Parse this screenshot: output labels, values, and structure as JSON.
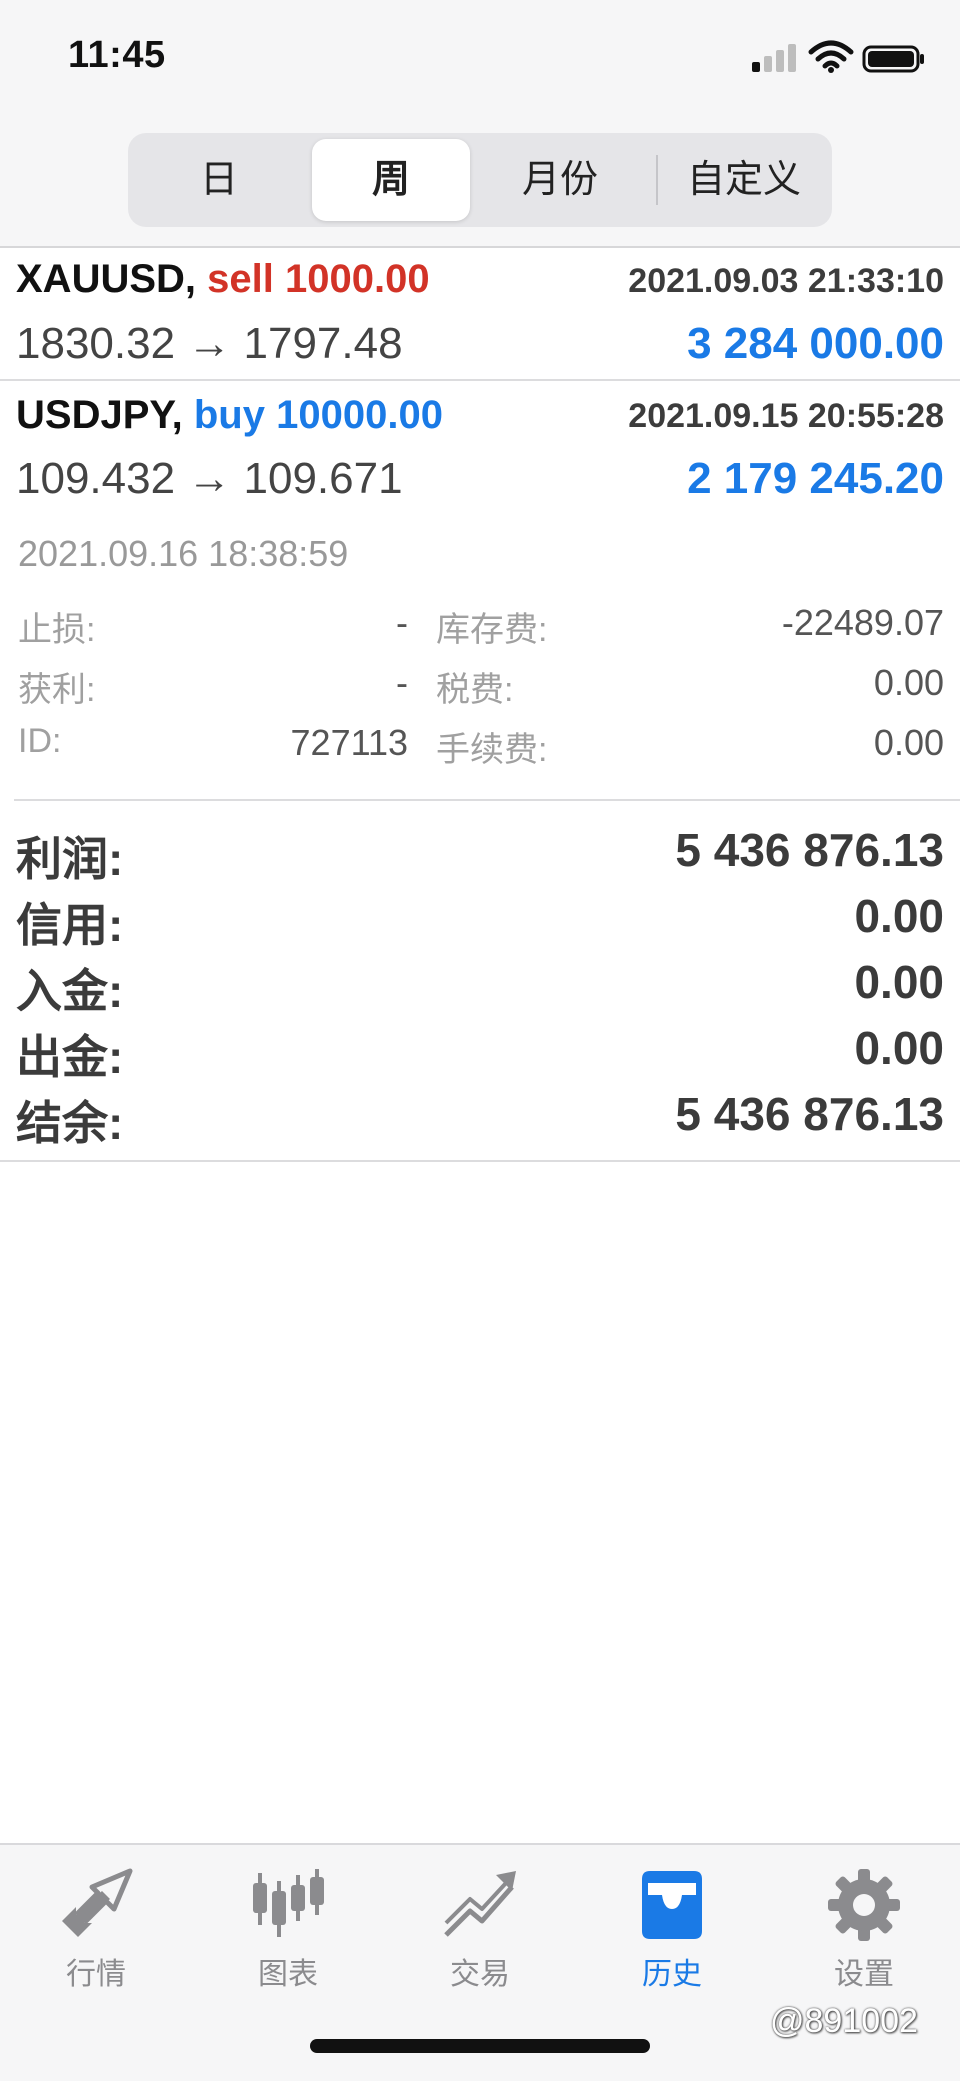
{
  "status_bar": {
    "time": "11:45"
  },
  "period_tabs": {
    "day": "日",
    "week": "周",
    "month": "月份",
    "custom": "自定义",
    "selected": "周"
  },
  "trades": [
    {
      "symbol": "XAUUSD,",
      "side_label": "sell 1000.00",
      "side": "sell",
      "datetime": "2021.09.03 21:33:10",
      "prices": "1830.32 → 1797.48",
      "profit": "3 284 000.00"
    },
    {
      "symbol": "USDJPY,",
      "side_label": "buy 10000.00",
      "side": "buy",
      "datetime": "2021.09.15 20:55:28",
      "prices": "109.432 → 109.671",
      "profit": "2 179 245.20"
    }
  ],
  "details": {
    "close_time": "2021.09.16 18:38:59",
    "stop_loss_label": "止损:",
    "stop_loss": "-",
    "take_profit_label": "获利:",
    "take_profit": "-",
    "id_label": "ID:",
    "id": "727113",
    "swap_label": "库存费:",
    "swap": "-22489.07",
    "tax_label": "税费:",
    "tax": "0.00",
    "commission_label": "手续费:",
    "commission": "0.00"
  },
  "summary": {
    "profit_label": "利润:",
    "profit": "5 436 876.13",
    "credit_label": "信用:",
    "credit": "0.00",
    "deposit_label": "入金:",
    "deposit": "0.00",
    "withdrawal_label": "出金:",
    "withdrawal": "0.00",
    "balance_label": "结余:",
    "balance": "5 436 876.13"
  },
  "tabbar": {
    "items": [
      {
        "label": "行情",
        "icon": "quotes-arrows-icon"
      },
      {
        "label": "图表",
        "icon": "candlestick-chart-icon"
      },
      {
        "label": "交易",
        "icon": "trade-trend-icon"
      },
      {
        "label": "历史",
        "icon": "history-inbox-icon"
      },
      {
        "label": "设置",
        "icon": "settings-gear-icon"
      }
    ],
    "active": "历史"
  },
  "watermark": "@891002",
  "colors": {
    "accent": "#1a7ae6",
    "sell": "#d23327",
    "buy": "#1a7ae6"
  }
}
